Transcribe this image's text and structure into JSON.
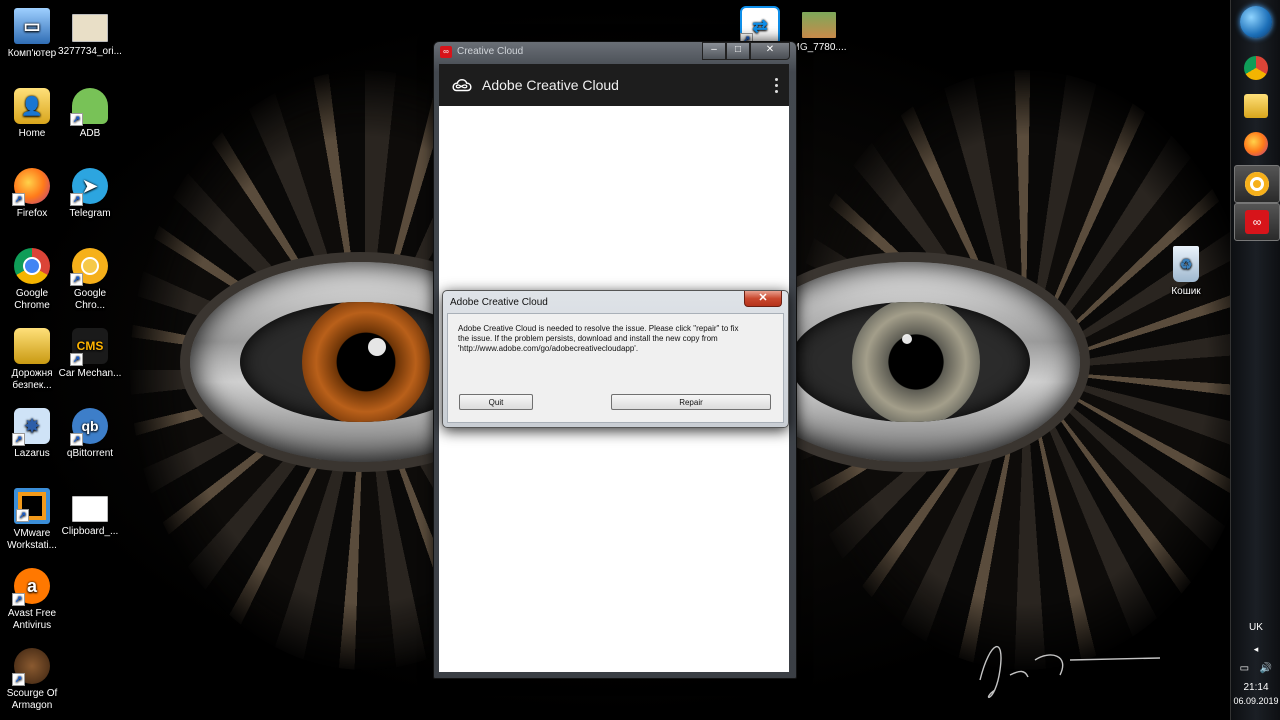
{
  "desktop": {
    "icons": [
      {
        "label": "Комп'ютер",
        "icon": "computer-icon"
      },
      {
        "label": "3277734_ori...",
        "icon": "image-file-icon"
      },
      {
        "label": "Home",
        "icon": "user-folder-icon"
      },
      {
        "label": "ADB",
        "icon": "android-icon"
      },
      {
        "label": "Firefox",
        "icon": "firefox-icon"
      },
      {
        "label": "Telegram",
        "icon": "telegram-icon"
      },
      {
        "label": "Google Chrome",
        "icon": "chrome-icon"
      },
      {
        "label": "Google Chro...",
        "icon": "chrome-canary-icon"
      },
      {
        "label": "Дорожня безпек...",
        "icon": "folder-icon"
      },
      {
        "label": "Car Mechan...",
        "icon": "cms-game-icon"
      },
      {
        "label": "Lazarus",
        "icon": "lazarus-icon"
      },
      {
        "label": "qBittorrent",
        "icon": "qbittorrent-icon"
      },
      {
        "label": "VMware Workstati...",
        "icon": "vmware-icon"
      },
      {
        "label": "Clipboard_...",
        "icon": "clipboard-file-icon"
      },
      {
        "label": "Avast Free Antivirus",
        "icon": "avast-icon"
      },
      {
        "label": "Scourge Of Armagon",
        "icon": "quake-icon"
      },
      {
        "label": "MG_7780....",
        "icon": "photo-file-icon"
      },
      {
        "label": "Кошик",
        "icon": "recycle-bin-icon"
      }
    ]
  },
  "cc_window": {
    "title": "Creative Cloud",
    "brand": "Adobe Creative Cloud",
    "controls": [
      "–",
      "□",
      "✕"
    ]
  },
  "dialog": {
    "title": "Adobe Creative Cloud",
    "close_label": "✕",
    "message_lines": [
      "Adobe Creative Cloud is needed to resolve the issue. Please click \"repair\" to fix",
      "the issue. If the problem persists, download and install the new copy from",
      "'http://www.adobe.com/go/adobecreativecloudapp'."
    ],
    "quit_label": "Quit",
    "repair_label": "Repair"
  },
  "taskbar": {
    "apps": [
      "chrome-icon",
      "explorer-icon",
      "firefox-icon",
      "chrome-canary-icon",
      "creative-cloud-icon"
    ],
    "language": "UK",
    "time": "21:14",
    "date": "06.09.2019"
  },
  "colors": {
    "adobe_red": "#d7141a",
    "cc_header": "#1d1d1d",
    "taskbar": "#1b1f25"
  }
}
